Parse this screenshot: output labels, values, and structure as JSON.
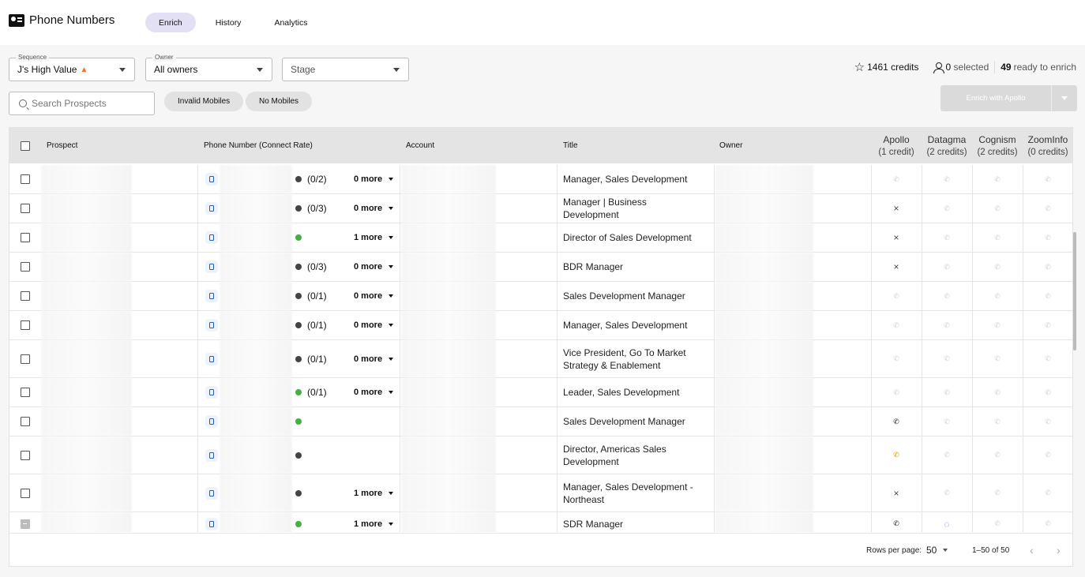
{
  "app": {
    "title": "Phone Numbers"
  },
  "tabs": [
    {
      "label": "Enrich",
      "active": true
    },
    {
      "label": "History",
      "active": false
    },
    {
      "label": "Analytics",
      "active": false
    }
  ],
  "filters": {
    "sequence": {
      "label": "Sequence",
      "value": "J's High Value",
      "icon": "fire-icon"
    },
    "owner": {
      "label": "Owner",
      "value": "All owners"
    },
    "stage": {
      "placeholder": "Stage"
    }
  },
  "status": {
    "credits_count": "1461",
    "credits_text": "credits",
    "selected_count": "0",
    "selected_text": "selected",
    "ready_count": "49",
    "ready_text": "ready to enrich"
  },
  "search": {
    "placeholder": "Search Prospects"
  },
  "chips": [
    "Invalid Mobiles",
    "No Mobiles"
  ],
  "enrich_button": {
    "label": "Enrich with Apollo"
  },
  "table": {
    "headers": {
      "prospect": "Prospect",
      "phone": "Phone Number (Connect Rate)",
      "account": "Account",
      "title": "Title",
      "owner": "Owner"
    },
    "providers": [
      {
        "name": "Apollo",
        "credits": "(1 credit)"
      },
      {
        "name": "Datagma",
        "credits": "(2 credits)"
      },
      {
        "name": "Cognism",
        "credits": "(2 credits)"
      },
      {
        "name": "ZoomInfo",
        "credits": "(0 credits)"
      }
    ],
    "rows": [
      {
        "rate": "(0/2)",
        "dot": "k",
        "more": "0 more",
        "title": "Manager, Sales Development",
        "apollo": "phone-faint"
      },
      {
        "rate": "(0/3)",
        "dot": "k",
        "more": "0 more",
        "title": "Manager | Business Development",
        "apollo": "x"
      },
      {
        "rate": "",
        "dot": "g",
        "more": "1 more",
        "title": "Director of Sales Development",
        "apollo": "x"
      },
      {
        "rate": "(0/3)",
        "dot": "k",
        "more": "0 more",
        "title": "BDR Manager",
        "apollo": "x"
      },
      {
        "rate": "(0/1)",
        "dot": "k",
        "more": "0 more",
        "title": "Sales Development Manager",
        "apollo": "phone-faint"
      },
      {
        "rate": "(0/1)",
        "dot": "k",
        "more": "0 more",
        "title": "Manager, Sales Development",
        "apollo": "phone-faint"
      },
      {
        "rate": "(0/1)",
        "dot": "k",
        "more": "0 more",
        "title": "Vice President, Go To Market Strategy & Enablement",
        "apollo": "phone-faint"
      },
      {
        "rate": "(0/1)",
        "dot": "g",
        "more": "0 more",
        "title": "Leader, Sales Development",
        "apollo": "phone-faint"
      },
      {
        "rate": "",
        "dot": "g",
        "more": "",
        "title": "Sales Development Manager",
        "apollo": "phone-dark"
      },
      {
        "rate": "",
        "dot": "k",
        "more": "",
        "title": "Director, Americas Sales Development",
        "apollo": "phone-orange"
      },
      {
        "rate": "",
        "dot": "k",
        "more": "1 more",
        "title": "Manager, Sales Development - Northeast",
        "apollo": "x"
      },
      {
        "rate": "",
        "dot": "g",
        "more": "1 more",
        "title": "SDR Manager",
        "apollo": "phone-dark",
        "datagma": "spinner",
        "checkbox": "indeterminate"
      }
    ]
  },
  "pagination": {
    "rows_per_page_label": "Rows per page:",
    "rows_per_page": "50",
    "range": "1–50 of 50",
    "prev": "‹",
    "next": "›"
  },
  "glyphs": {
    "star": "☆",
    "phone": "✆",
    "x": "×",
    "spinner": "◌"
  },
  "colors": {
    "active_tab": "#e3e0f5",
    "connected": "#44b044",
    "not_connected": "#444444",
    "mobile_icon": "#1f5fb8"
  }
}
